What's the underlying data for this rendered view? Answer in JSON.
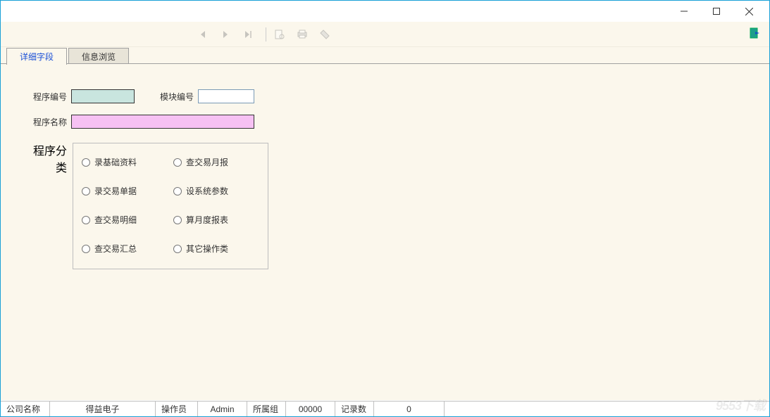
{
  "tabs": {
    "detail": "详细字段",
    "browse": "信息浏览"
  },
  "form": {
    "program_id_label": "程序编号",
    "program_id_value": "",
    "module_id_label": "模块编号",
    "module_id_value": "",
    "program_name_label": "程序名称",
    "program_name_value": "",
    "category_label": "程序分类"
  },
  "categories": {
    "c0": "录基础资料",
    "c1": "查交易月报",
    "c2": "录交易单据",
    "c3": "设系统参数",
    "c4": "查交易明细",
    "c5": "算月度报表",
    "c6": "查交易汇总",
    "c7": "其它操作类"
  },
  "status": {
    "company_label": "公司名称",
    "company_value": "得益电子",
    "operator_label": "操作员",
    "operator_value": "Admin",
    "group_label": "所属组",
    "group_value": "00000",
    "record_label": "记录数",
    "record_value": "0"
  },
  "watermark": "9553下载"
}
